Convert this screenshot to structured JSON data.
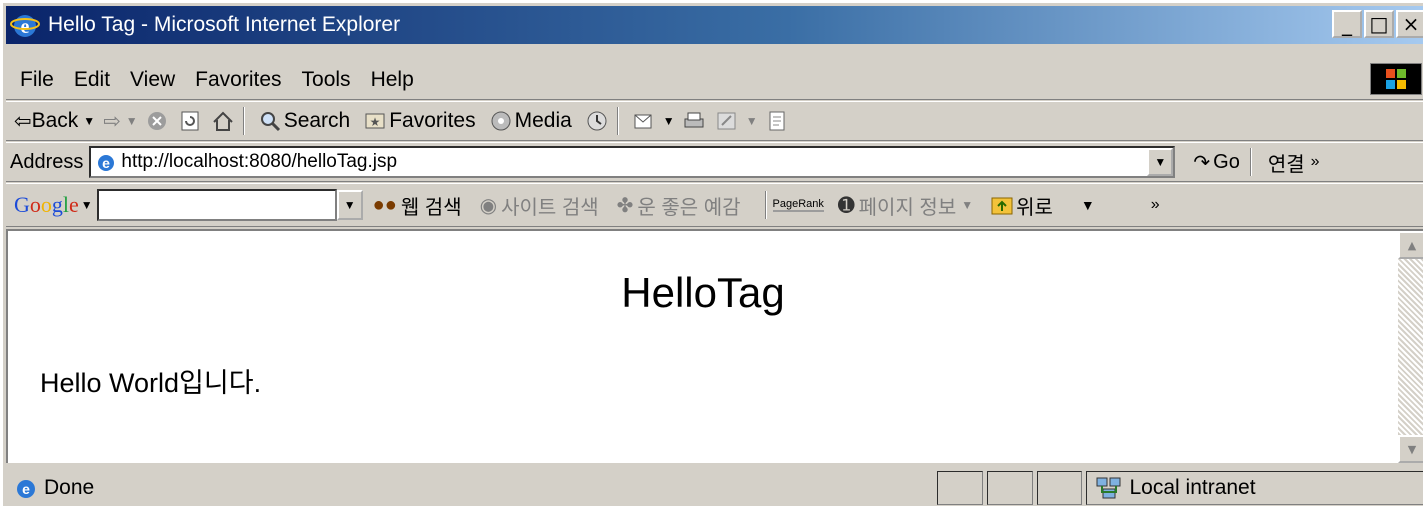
{
  "window": {
    "title": "Hello Tag - Microsoft Internet Explorer",
    "minimize": "_",
    "maximize": "□",
    "close": "×"
  },
  "menu": [
    "File",
    "Edit",
    "View",
    "Favorites",
    "Tools",
    "Help"
  ],
  "toolbar": {
    "back": "Back",
    "search": "Search",
    "favorites": "Favorites",
    "media": "Media"
  },
  "address": {
    "label": "Address",
    "url": "http://localhost:8080/helloTag.jsp",
    "go": "Go",
    "links": "연결"
  },
  "google": {
    "logo": [
      "G",
      "o",
      "o",
      "g",
      "l",
      "e"
    ],
    "web_search": "웹 검색",
    "site_search": "사이트 검색",
    "lucky": "운 좋은 예감",
    "pagerank": "PageRank",
    "page_info": "페이지 정보",
    "up": "위로"
  },
  "page": {
    "heading": "HelloTag",
    "text": "Hello World입니다."
  },
  "status": {
    "text": "Done",
    "zone": "Local intranet"
  }
}
